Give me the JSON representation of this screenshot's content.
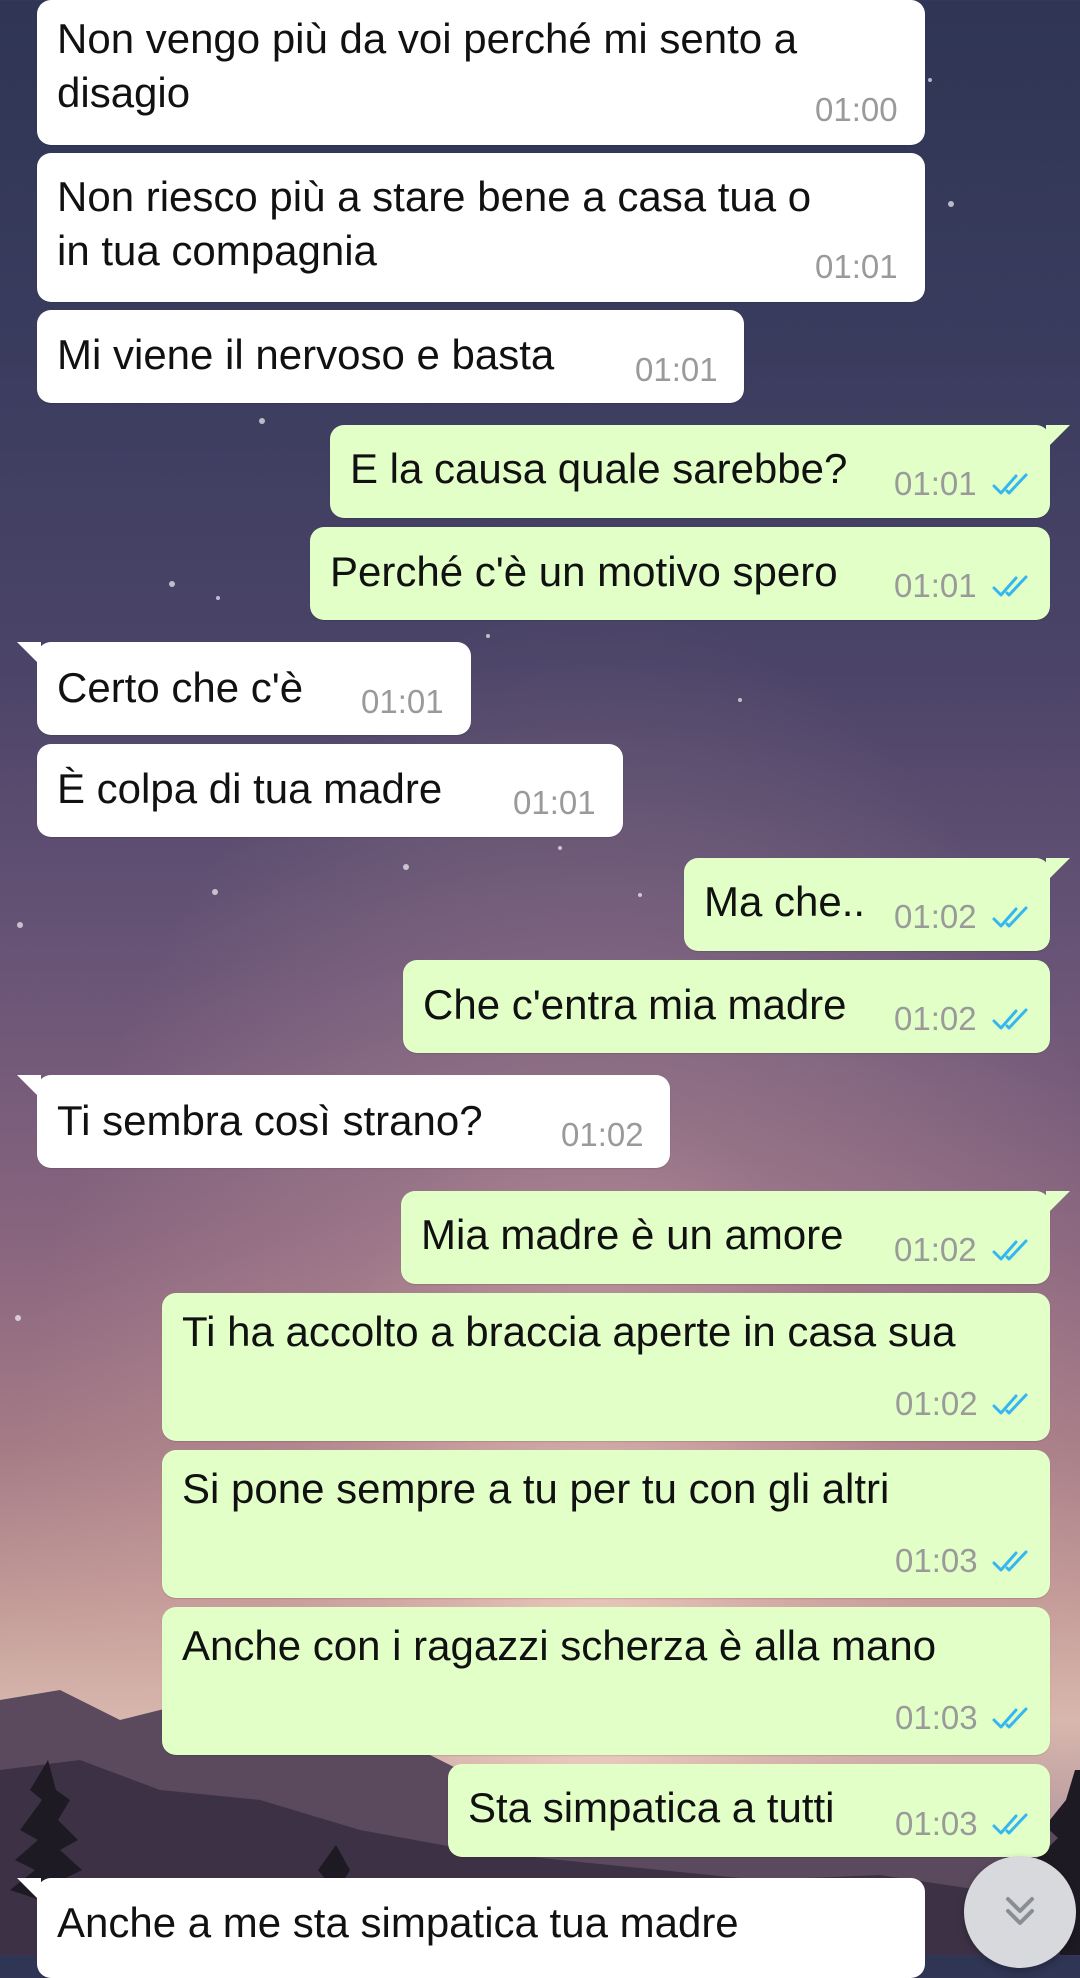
{
  "messages": [
    {
      "text_lines": [
        "Non vengo più da voi perché mi sento a",
        "disagio"
      ],
      "time": "01:00",
      "direction": "incoming"
    },
    {
      "text_lines": [
        "Non riesco più a stare bene a casa tua o",
        "in tua compagnia"
      ],
      "time": "01:01",
      "direction": "incoming"
    },
    {
      "text_lines": [
        "Mi viene il nervoso e basta"
      ],
      "time": "01:01",
      "direction": "incoming"
    },
    {
      "text_lines": [
        "E la causa quale sarebbe?"
      ],
      "time": "01:01",
      "direction": "outgoing",
      "status": "read"
    },
    {
      "text_lines": [
        "Perché c'è un motivo spero"
      ],
      "time": "01:01",
      "direction": "outgoing",
      "status": "read"
    },
    {
      "text_lines": [
        "Certo che c'è"
      ],
      "time": "01:01",
      "direction": "incoming"
    },
    {
      "text_lines": [
        "È colpa di tua madre"
      ],
      "time": "01:01",
      "direction": "incoming"
    },
    {
      "text_lines": [
        "Ma che.."
      ],
      "time": "01:02",
      "direction": "outgoing",
      "status": "read"
    },
    {
      "text_lines": [
        "Che c'entra mia madre"
      ],
      "time": "01:02",
      "direction": "outgoing",
      "status": "read"
    },
    {
      "text_lines": [
        "Ti sembra così strano?"
      ],
      "time": "01:02",
      "direction": "incoming"
    },
    {
      "text_lines": [
        "Mia madre è un amore"
      ],
      "time": "01:02",
      "direction": "outgoing",
      "status": "read"
    },
    {
      "text_lines": [
        "Ti ha accolto a braccia aperte in casa sua"
      ],
      "time": "01:02",
      "direction": "outgoing",
      "status": "read"
    },
    {
      "text_lines": [
        "Si pone sempre a tu per tu con gli altri"
      ],
      "time": "01:03",
      "direction": "outgoing",
      "status": "read"
    },
    {
      "text_lines": [
        "Anche con i ragazzi scherza è alla mano"
      ],
      "time": "01:03",
      "direction": "outgoing",
      "status": "read"
    },
    {
      "text_lines": [
        "Sta simpatica a tutti"
      ],
      "time": "01:03",
      "direction": "outgoing",
      "status": "read"
    },
    {
      "text_lines": [
        "Anche a me sta simpatica tua madre"
      ],
      "time": "",
      "direction": "incoming"
    }
  ],
  "scroll_button": {
    "icon": "double-chevron-down-icon"
  },
  "colors": {
    "incoming_bubble": "#ffffff",
    "outgoing_bubble": "#e2ffc8",
    "read_ticks": "#34b7f1",
    "time_text": "#9a9a9a"
  }
}
